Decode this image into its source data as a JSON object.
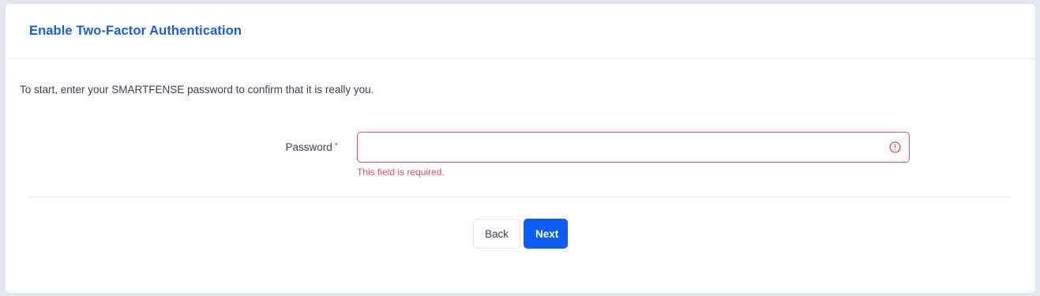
{
  "header": {
    "title": "Enable Two-Factor Authentication"
  },
  "intro_text": "To start, enter your SMARTFENSE password to confirm that it is really you.",
  "form": {
    "password_label": "Password",
    "required_marker": "*",
    "password_value": "",
    "error_message": "This field is required.",
    "error_icon": "exclamation-circle-icon"
  },
  "actions": {
    "back_label": "Back",
    "next_label": "Next"
  },
  "colors": {
    "accent": "#0d5cf5",
    "title": "#1a5fd6",
    "error": "#e54e63"
  }
}
